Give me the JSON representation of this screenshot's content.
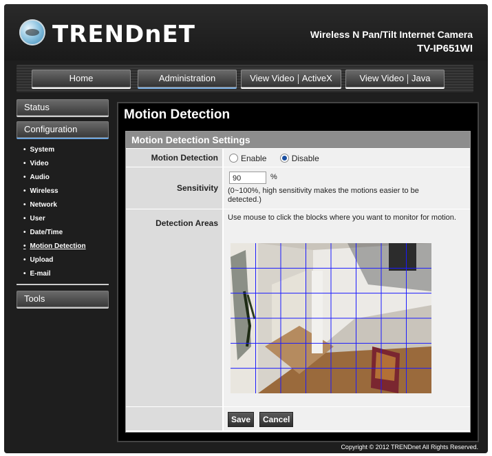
{
  "brand": {
    "logo_text": "TRENDnET"
  },
  "product": {
    "title": "Wireless N Pan/Tilt Internet Camera",
    "model": "TV-IP651WI"
  },
  "nav": {
    "home": "Home",
    "administration": "Administration",
    "view_video_activex": [
      "View Video",
      "ActiveX"
    ],
    "view_video_java": [
      "View Video",
      "Java"
    ]
  },
  "sidebar": {
    "status": "Status",
    "configuration": "Configuration",
    "items": [
      "System",
      "Video",
      "Audio",
      "Wireless",
      "Network",
      "User",
      "Date/Time",
      "Motion Detection",
      "Upload",
      "E-mail"
    ],
    "current_item": "Motion Detection",
    "tools": "Tools"
  },
  "page": {
    "title": "Motion Detection",
    "section_title": "Motion Detection Settings"
  },
  "form": {
    "motion_detection": {
      "label": "Motion Detection",
      "options": [
        "Enable",
        "Disable"
      ],
      "selected": "Disable"
    },
    "sensitivity": {
      "label": "Sensitivity",
      "value": "90",
      "unit": "%",
      "hint": "(0~100%, high sensitivity makes the motions easier to be detected.)"
    },
    "detection_areas": {
      "label": "Detection Areas",
      "hint": "Use mouse to click the blocks where you want to monitor for motion."
    },
    "grid": {
      "columns": 8,
      "rows": 6
    }
  },
  "buttons": {
    "save": "Save",
    "cancel": "Cancel"
  },
  "footer": {
    "copyright": "Copyright © 2012 TRENDnet   All Rights Reserved."
  },
  "colors": {
    "grid_line": "#1a1aff",
    "accent": "#6aa3dd",
    "header_bg": "#1e1e1e"
  }
}
